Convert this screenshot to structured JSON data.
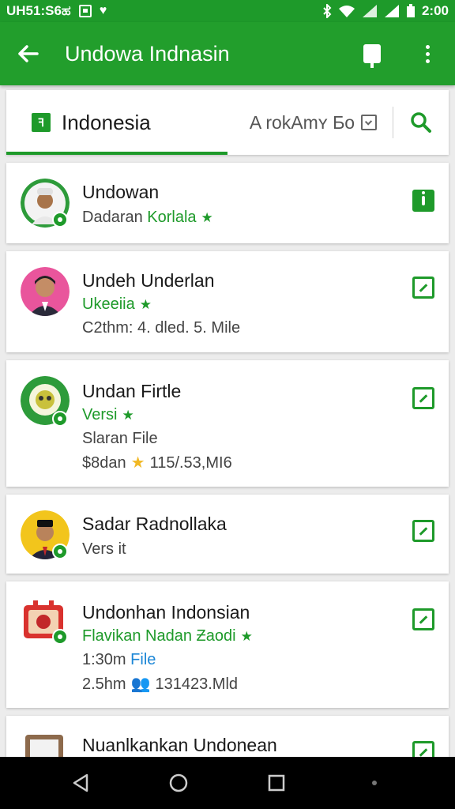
{
  "status_bar": {
    "time_left": "UH51:S6ಹ",
    "time_right": "2:00"
  },
  "app_bar": {
    "title": "Undowa Indnasin"
  },
  "tabs": {
    "active_label": "Indonesia",
    "secondary_label": "A rokAmʏ Ƃo"
  },
  "items": [
    {
      "title": "Undowan",
      "line1_prefix": "Dadaran",
      "line1_green": "Korlala",
      "action": "info"
    },
    {
      "title": "Undeh Underlan",
      "line1_green": "Ukeeiia",
      "line2": "C2thm: 4. dled. 5. Mile",
      "action": "edit"
    },
    {
      "title": "Undan Firtle",
      "line1_green": "Versi",
      "line2": "Slaran File",
      "line3_prefix": "$8dan",
      "line3_suffix": "115/.53,MI6",
      "action": "edit"
    },
    {
      "title": "Sadar Radnollaka",
      "line1": "Vers it",
      "action": "edit"
    },
    {
      "title": "Undonhan Indonsian",
      "line1_green": "Flavikan Nadan Ƶaodi",
      "line2_prefix": "1:30m",
      "line2_blue": "File",
      "line3_prefix": "2.5hm",
      "line3_suffix": "131423.Mld",
      "action": "edit"
    },
    {
      "title": "Nuanlkankan Undonean",
      "action": "edit"
    }
  ],
  "colors": {
    "brand_green": "#229e2c",
    "status_green": "#1e9a2a",
    "star_gold": "#f1b824",
    "link_blue": "#1b86d6"
  }
}
